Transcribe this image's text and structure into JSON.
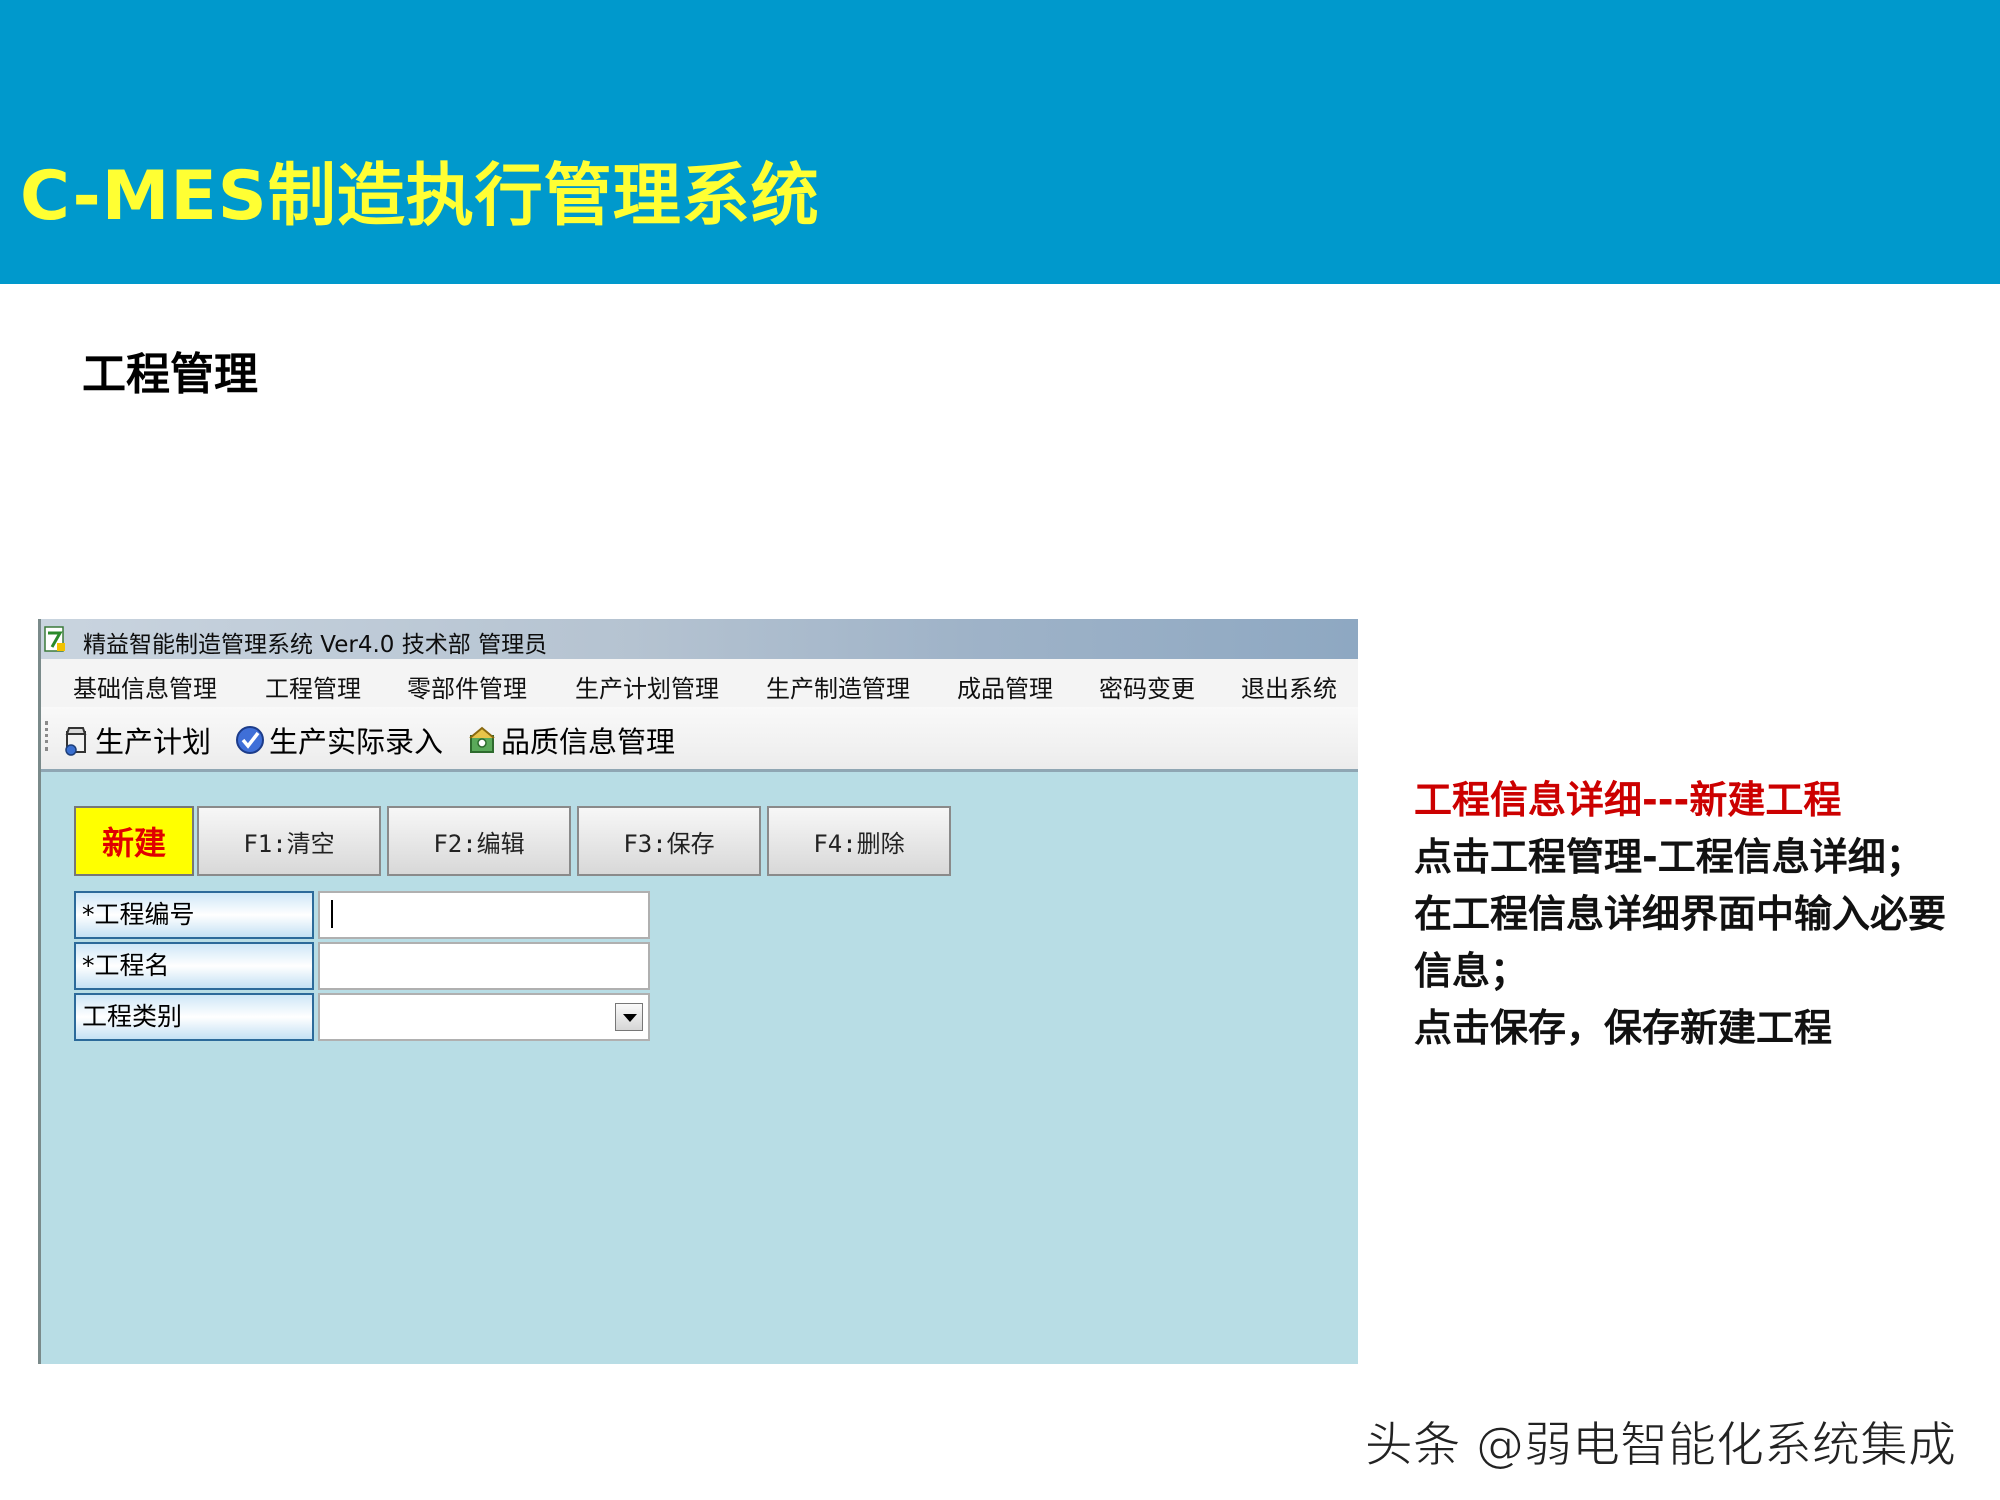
{
  "slide": {
    "title": "C-MES制造执行管理系统",
    "section": "工程管理"
  },
  "window": {
    "title": "精益智能制造管理系统 Ver4.0 技术部 管理员"
  },
  "menu": {
    "items": [
      "基础信息管理",
      "工程管理",
      "零部件管理",
      "生产计划管理",
      "生产制造管理",
      "成品管理",
      "密码变更",
      "退出系统"
    ]
  },
  "toolbar": {
    "items": [
      {
        "label": "生产计划",
        "icon": "production-plan-icon"
      },
      {
        "label": "生产实际录入",
        "icon": "checkmark-icon"
      },
      {
        "label": "品质信息管理",
        "icon": "quality-icon"
      }
    ]
  },
  "buttons": {
    "new": "新建",
    "clear": "F1:清空",
    "edit": "F2:编辑",
    "save": "F3:保存",
    "delete": "F4:删除"
  },
  "form": {
    "project_no_label": "*工程编号",
    "project_no_value": "",
    "project_name_label": "*工程名",
    "project_name_value": "",
    "project_type_label": "工程类别",
    "project_type_value": ""
  },
  "description": {
    "heading": "工程信息详细---新建工程",
    "lines": [
      "点击工程管理-工程信息详细；",
      "在工程信息详细界面中输入必要信息；",
      "点击保存，保存新建工程"
    ]
  },
  "watermark": "头条 @弱电智能化系统集成",
  "colors": {
    "header": "#0099cc",
    "title": "#ffff33",
    "app_background": "#b8dde5",
    "new_button": "#ffff00",
    "heading_red": "#cc0000"
  }
}
